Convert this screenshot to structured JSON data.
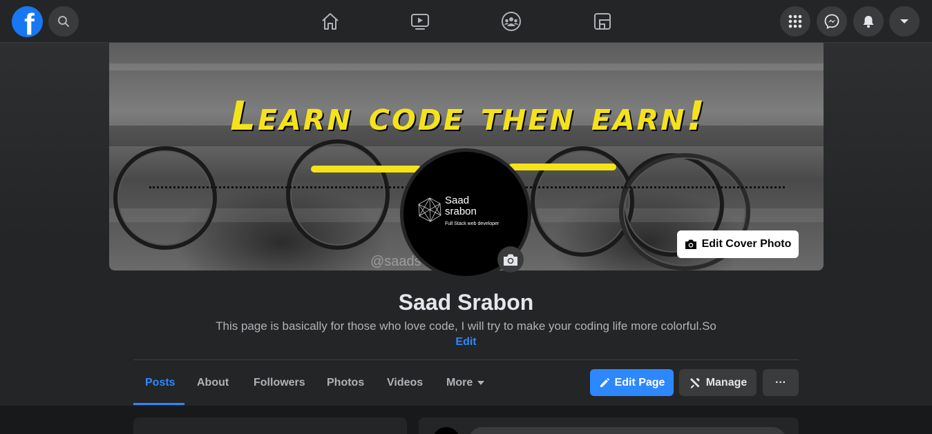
{
  "topbar": {
    "logo_letter": "f",
    "icons": {
      "search": "search-icon",
      "home": "home-icon",
      "watch": "watch-icon",
      "groups": "groups-icon",
      "gaming": "gaming-icon",
      "menu": "grid-menu-icon",
      "messenger": "messenger-icon",
      "notifications": "bell-icon",
      "account": "chevron-down-icon"
    }
  },
  "cover": {
    "title": "Learn code then earn!",
    "watermark": "@saads",
    "edit_button_label": "Edit Cover Photo"
  },
  "avatar": {
    "name_line1": "Saad",
    "name_line2": "srabon",
    "subtitle": "Full Stack web developer"
  },
  "page": {
    "name": "Saad Srabon",
    "bio": "This page is basically for those who love code, I will try to make your coding life more colorful.So",
    "bio_edit": "Edit"
  },
  "tabs": [
    {
      "label": "Posts",
      "active": true
    },
    {
      "label": "About",
      "active": false
    },
    {
      "label": "Followers",
      "active": false
    },
    {
      "label": "Photos",
      "active": false
    },
    {
      "label": "Videos",
      "active": false
    },
    {
      "label": "More",
      "active": false
    }
  ],
  "actions": {
    "edit_page": "Edit Page",
    "manage": "Manage",
    "more": "···"
  },
  "colors": {
    "accent": "#2d88ff",
    "brand": "#1877f2",
    "cover_text": "#f5e31a",
    "background": "#18191a",
    "surface": "#242526"
  }
}
